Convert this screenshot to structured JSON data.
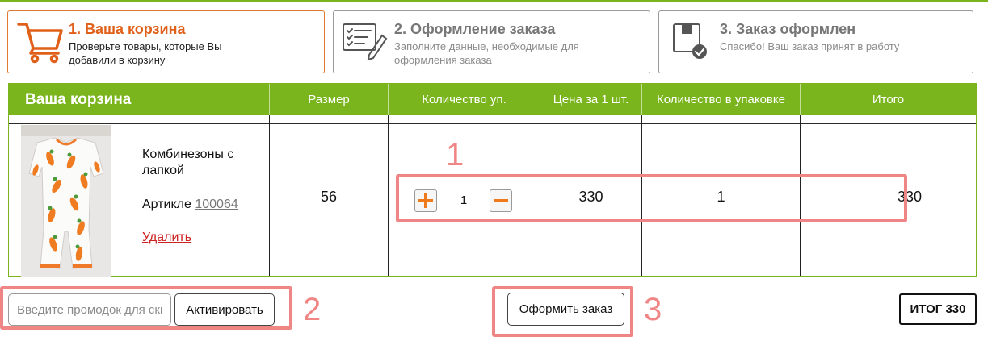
{
  "steps": [
    {
      "title": "1. Ваша корзина",
      "desc_line1": "Проверьте товары, которые Вы",
      "desc_line2": "добавили в корзину",
      "icon": "cart-icon"
    },
    {
      "title": "2. Оформление заказа",
      "desc_line1": "Заполните данные, необходимые для",
      "desc_line2": "оформления заказа",
      "icon": "checklist-icon"
    },
    {
      "title": "3. Заказ оформлен",
      "desc_line1": "Спасибо! Ваш заказ принят в работу",
      "desc_line2": "",
      "icon": "box-check-icon"
    }
  ],
  "table": {
    "headers": [
      "Ваша корзина",
      "Размер",
      "Количество уп.",
      "Цена за 1 шт.",
      "Количество в упаковке",
      "Итого"
    ],
    "item": {
      "name": "Комбинезоны с лапкой",
      "sku_label": "Артикле",
      "sku": "100064",
      "delete": "Удалить",
      "size": "56",
      "qty": "1",
      "price": "330",
      "pack_qty": "1",
      "total": "330"
    }
  },
  "promo": {
    "placeholder": "Введите промодок для скидки",
    "activate": "Активировать"
  },
  "checkout": "Оформить заказ",
  "total": {
    "label": "ИТОГ",
    "value": "330"
  },
  "annotations": [
    "1",
    "2",
    "3"
  ],
  "colors": {
    "brand_green": "#7ab51d",
    "accent_orange": "#e0601a",
    "annotation_red": "#f08585",
    "delete_red": "#cc2222"
  }
}
